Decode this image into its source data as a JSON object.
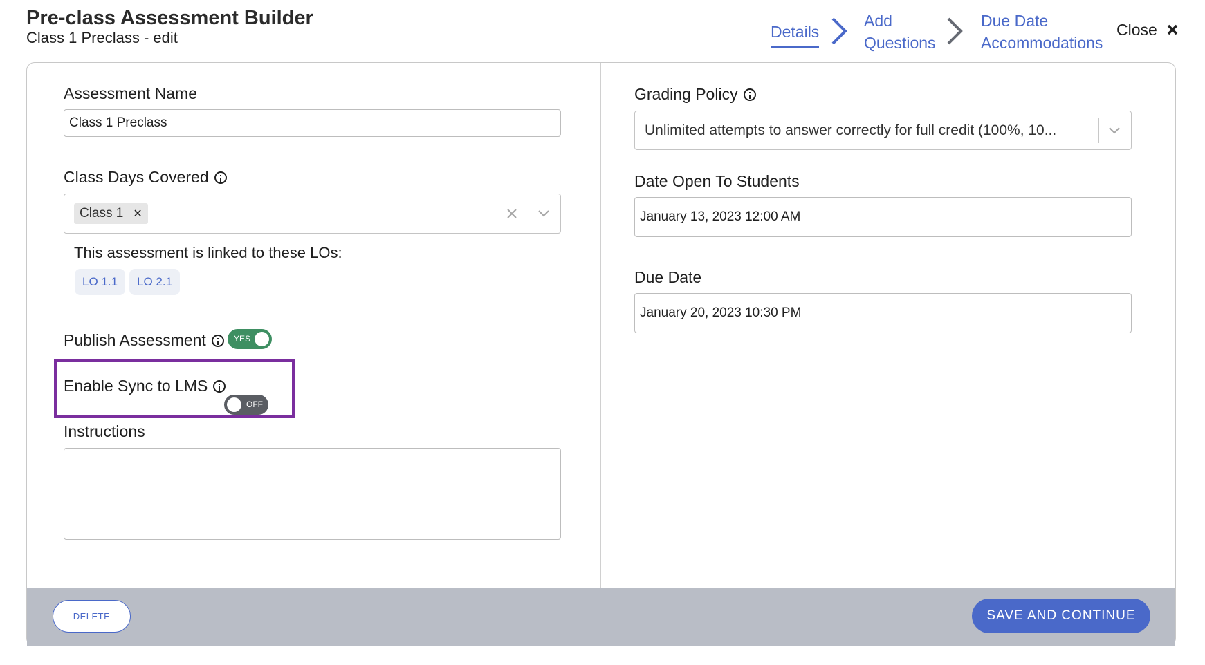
{
  "header": {
    "title": "Pre-class Assessment Builder",
    "subtitle": "Class 1 Preclass - edit",
    "steps": [
      {
        "label": "Details",
        "active": true
      },
      {
        "label": "Add Questions"
      },
      {
        "label": "Due Date Accommodations"
      }
    ],
    "close_label": "Close",
    "accent_color": "#4a69c9"
  },
  "left": {
    "assessment_name_label": "Assessment Name",
    "assessment_name_value": "Class 1 Preclass",
    "class_days_label": "Class Days Covered",
    "class_days_selected": [
      "Class 1"
    ],
    "lo_text": "This assessment is linked to these LOs:",
    "los": [
      "LO 1.1",
      "LO 2.1"
    ],
    "publish_label": "Publish Assessment",
    "publish_toggle": "YES",
    "sync_label": "Enable Sync to LMS",
    "sync_toggle": "OFF",
    "instructions_label": "Instructions",
    "instructions_value": ""
  },
  "right": {
    "grading_label": "Grading Policy",
    "grading_value": "Unlimited attempts to answer correctly for full credit (100%, 10...",
    "open_label": "Date Open To Students",
    "open_value": "January 13, 2023 12:00 AM",
    "due_label": "Due Date",
    "due_value": "January 20, 2023 10:30 PM"
  },
  "footer": {
    "delete_label": "DELETE",
    "save_label": "SAVE AND CONTINUE"
  },
  "colors": {
    "toggle_on": "#3e8f62",
    "toggle_off": "#5a5d63",
    "highlight": "#7a2e9e",
    "footer_bg": "#b9bdc6"
  }
}
